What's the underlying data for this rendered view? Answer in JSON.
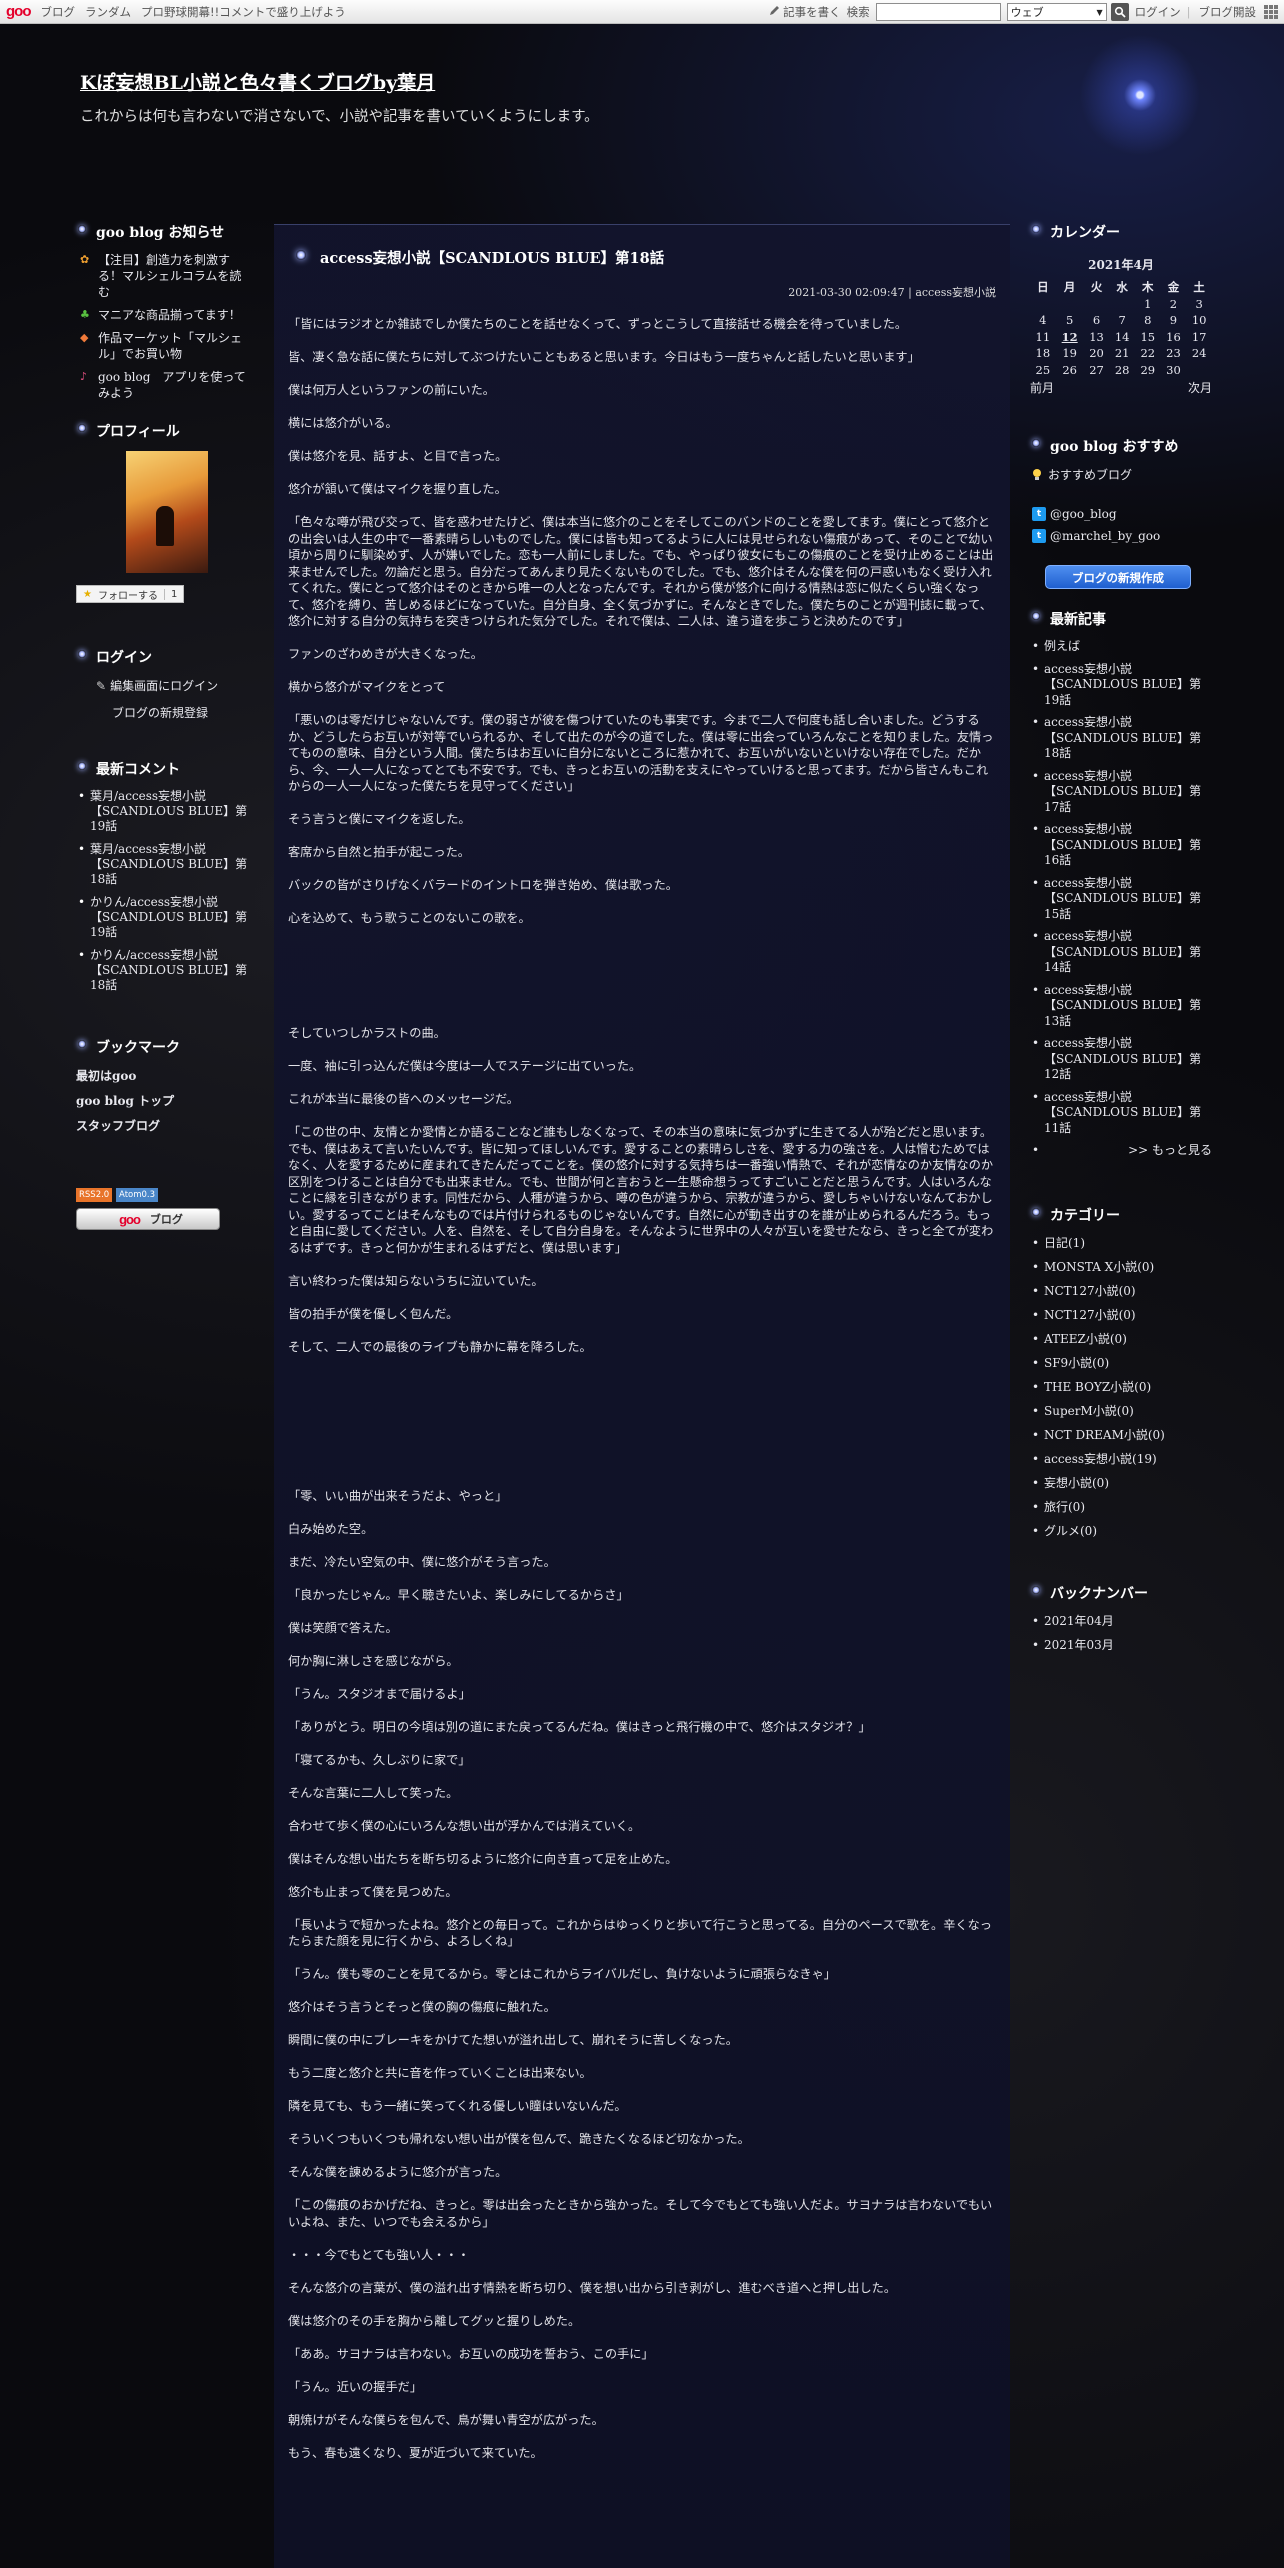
{
  "topbar": {
    "logo": "goo",
    "links": [
      "ブログ",
      "ランダム",
      "プロ野球開幕!!コメントで盛り上げよう"
    ],
    "write_label": "記事を書く",
    "search_label": "検索",
    "search_scope": "ウェブ",
    "login": "ログイン",
    "open_blog": "ブログ開設"
  },
  "header": {
    "title": "Kぽ妄想BL小説と色々書くブログby葉月",
    "description": "これからは何も言わないで消さないで、小説や記事を書いていくようにします。"
  },
  "left": {
    "notices_title": "goo blog お知らせ",
    "notices": [
      {
        "icon": "lion-icon",
        "text": "【注目】創造力を刺激する！マルシェルコラムを読む"
      },
      {
        "icon": "clover-icon",
        "text": "マニアな商品揃ってます！"
      },
      {
        "icon": "diamond-icon",
        "text": "作品マーケット「マルシェル」でお買い物"
      },
      {
        "icon": "music-icon",
        "text": "goo blog　アプリを使ってみよう"
      }
    ],
    "profile_title": "プロフィール",
    "follow_label": "フォローする",
    "follow_count": "1",
    "login_title": "ログイン",
    "login_edit": "編集画面にログイン",
    "login_register": "ブログの新規登録",
    "recent_comments_title": "最新コメント",
    "recent_comments": [
      "葉月/access妄想小説【SCANDLOUS BLUE】第19話",
      "葉月/access妄想小説【SCANDLOUS BLUE】第18話",
      "かりん/access妄想小説【SCANDLOUS BLUE】第19話",
      "かりん/access妄想小説【SCANDLOUS BLUE】第18話"
    ],
    "bookmarks_title": "ブックマーク",
    "bookmarks": [
      "最初はgoo",
      "goo blog トップ",
      "スタッフブログ"
    ],
    "badge_rss": "RSS2.0",
    "badge_atom": "Atom0.3",
    "banner_logo": "goo",
    "banner_text": "ブログ"
  },
  "post": {
    "title": "access妄想小説【SCANDLOUS BLUE】第18話",
    "date": "2021-03-30 02:09:47",
    "category": "access妄想小説",
    "sep": "|",
    "part1": [
      "「皆にはラジオとか雑誌でしか僕たちのことを話せなくって、ずっとこうして直接話せる機会を待っていました。",
      "皆、凄く急な話に僕たちに対してぶつけたいこともあると思います。今日はもう一度ちゃんと話したいと思います」",
      "僕は何万人というファンの前にいた。",
      "横には悠介がいる。",
      "僕は悠介を見、話すよ、と目で言った。",
      "悠介が頷いて僕はマイクを握り直した。",
      "「色々な噂が飛び交って、皆を惑わせたけど、僕は本当に悠介のことをそしてこのバンドのことを愛してます。僕にとって悠介との出会いは人生の中で一番素晴らしいものでした。僕には皆も知ってるように人には見せられない傷痕があって、そのことで幼い頃から周りに馴染めず、人が嫌いでした。恋も一人前にしました。でも、やっぱり彼女にもこの傷痕のことを受け止めることは出来ませんでした。勿論だと思う。自分だってあんまり見たくないものでした。でも、悠介はそんな僕を何の戸惑いもなく受け入れてくれた。僕にとって悠介はそのときから唯一の人となったんです。それから僕が悠介に向ける情熱は恋に似たくらい強くなって、悠介を縛り、苦しめるほどになっていた。自分自身、全く気づかずに。そんなときでした。僕たちのことが週刊誌に載って、悠介に対する自分の気持ちを突きつけられた気分でした。それで僕は、二人は、違う道を歩こうと決めたのです」",
      "ファンのざわめきが大きくなった。",
      "横から悠介がマイクをとって",
      "「悪いのは零だけじゃないんです。僕の弱さが彼を傷つけていたのも事実です。今まで二人で何度も話し合いました。どうするか、どうしたらお互いが対等でいられるか、そして出たのが今の道でした。僕は零に出会っていろんなことを知りました。友情ってものの意味、自分という人間。僕たちはお互いに自分にないところに惹かれて、お互いがいないといけない存在でした。だから、今、一人一人になってとても不安です。でも、きっとお互いの活動を支えにやっていけると思ってます。だから皆さんもこれからの一人一人になった僕たちを見守ってください」",
      "そう言うと僕にマイクを返した。",
      "客席から自然と拍手が起こった。",
      "バックの皆がさりげなくバラードのイントロを弾き始め、僕は歌った。",
      "心を込めて、もう歌うことのないこの歌を。"
    ],
    "part2": [
      "そしていつしかラストの曲。",
      "一度、袖に引っ込んだ僕は今度は一人でステージに出ていった。",
      "これが本当に最後の皆へのメッセージだ。",
      "「この世の中、友情とか愛情とか語ることなど誰もしなくなって、その本当の意味に気づかずに生きてる人が殆どだと思います。でも、僕はあえて言いたいんです。皆に知ってほしいんです。愛することの素晴らしさを、愛する力の強さを。人は憎むためではなく、人を愛するために産まれてきたんだってことを。僕の悠介に対する気持ちは一番強い情熱で、それが恋情なのか友情なのか区別をつけることは自分でも出来ません。でも、世間が何と言おうと一生懸命想うってすごいことだと思うんです。人はいろんなことに縁を引きながります。同性だから、人種が違うから、噂の色が違うから、宗教が違うから、愛しちゃいけないなんておかしい。愛するってことはそんなものでは片付けられるものじゃないんです。自然に心が動き出すのを誰が止められるんだろう。もっと自由に愛してください。人を、自然を、そして自分自身を。そんなように世界中の人々が互いを愛せたなら、きっと全てが変わるはずです。きっと何かが生まれるはずだと、僕は思います」",
      "言い終わった僕は知らないうちに泣いていた。",
      "皆の拍手が僕を優しく包んだ。",
      "そして、二人での最後のライブも静かに幕を降ろした。"
    ],
    "part3": [
      "「零、いい曲が出来そうだよ、やっと」",
      "白み始めた空。",
      "まだ、冷たい空気の中、僕に悠介がそう言った。",
      "「良かったじゃん。早く聴きたいよ、楽しみにしてるからさ」",
      "僕は笑顔で答えた。",
      "何か胸に淋しさを感じながら。",
      "「うん。スタジオまで届けるよ」",
      "「ありがとう。明日の今頃は別の道にまた戻ってるんだね。僕はきっと飛行機の中で、悠介はスタジオ？」",
      "「寝てるかも、久しぶりに家で」",
      "そんな言葉に二人して笑った。",
      "合わせて歩く僕の心にいろんな想い出が浮かんでは消えていく。",
      "僕はそんな想い出たちを断ち切るように悠介に向き直って足を止めた。",
      "悠介も止まって僕を見つめた。",
      "「長いようで短かったよね。悠介との毎日って。これからはゆっくりと歩いて行こうと思ってる。自分のペースで歌を。辛くなったらまた顔を見に行くから、よろしくね」",
      "「うん。僕も零のことを見てるから。零とはこれからライバルだし、負けないように頑張らなきゃ」",
      "悠介はそう言うとそっと僕の胸の傷痕に触れた。",
      "瞬間に僕の中にブレーキをかけてた想いが溢れ出して、崩れそうに苦しくなった。",
      "もう二度と悠介と共に音を作っていくことは出来ない。",
      "隣を見ても、もう一緒に笑ってくれる優しい瞳はいないんだ。",
      "そういくつもいくつも帰れない想い出が僕を包んで、跪きたくなるほど切なかった。",
      "そんな僕を諌めるように悠介が言った。",
      "「この傷痕のおかげだね、きっと。零は出会ったときから強かった。そして今でもとても強い人だよ。サヨナラは言わないでもいいよね、また、いつでも会えるから」",
      "・・・今でもとても強い人・・・",
      "そんな悠介の言葉が、僕の溢れ出す情熱を断ち切り、僕を想い出から引き剥がし、進むべき道へと押し出した。",
      "僕は悠介のその手を胸から離してグッと握りしめた。",
      "「ああ。サヨナラは言わない。お互いの成功を誓おう、この手に」",
      "「うん。近いの握手だ」",
      "朝焼けがそんな僕らを包んで、鳥が舞い青空が広がった。",
      "もう、春も遠くなり、夏が近づいて来ていた。"
    ]
  },
  "right": {
    "calendar_title": "カレンダー",
    "calendar": {
      "month": "2021年4月",
      "weekdays": [
        "日",
        "月",
        "火",
        "水",
        "木",
        "金",
        "土"
      ],
      "days": [
        "1",
        "2",
        "3",
        "4",
        "5",
        "6",
        "7",
        "8",
        "9",
        "10",
        "11",
        "12",
        "13",
        "14",
        "15",
        "16",
        "17",
        "18",
        "19",
        "20",
        "21",
        "22",
        "23",
        "24",
        "25",
        "26",
        "27",
        "28",
        "29",
        "30"
      ],
      "first_weekday": 4,
      "today": "12",
      "prev": "前月",
      "next": "次月"
    },
    "recommend_title": "goo blog おすすめ",
    "recommend_link": "おすすめブログ",
    "twitter": [
      "@goo_blog",
      "@marchel_by_goo"
    ],
    "new_post_button": "ブログの新規作成",
    "recent_articles_title": "最新記事",
    "recent_articles": [
      "例えば",
      "access妄想小説【SCANDLOUS BLUE】第19話",
      "access妄想小説【SCANDLOUS BLUE】第18話",
      "access妄想小説【SCANDLOUS BLUE】第17話",
      "access妄想小説【SCANDLOUS BLUE】第16話",
      "access妄想小説【SCANDLOUS BLUE】第15話",
      "access妄想小説【SCANDLOUS BLUE】第14話",
      "access妄想小説【SCANDLOUS BLUE】第13話",
      "access妄想小説【SCANDLOUS BLUE】第12話",
      "access妄想小説【SCANDLOUS BLUE】第11話"
    ],
    "more": ">> もっと見る",
    "categories_title": "カテゴリー",
    "categories": [
      "日記(1)",
      "MONSTA X小説(0)",
      "NCT127小説(0)",
      "NCT127小説(0)",
      "ATEEZ小説(0)",
      "SF9小説(0)",
      "THE BOYZ小説(0)",
      "SuperM小説(0)",
      "NCT DREAM小説(0)",
      "access妄想小説(19)",
      "妄想小説(0)",
      "旅行(0)",
      "グルメ(0)"
    ],
    "backnumber_title": "バックナンバー",
    "backnumbers": [
      "2021年04月",
      "2021年03月"
    ]
  }
}
